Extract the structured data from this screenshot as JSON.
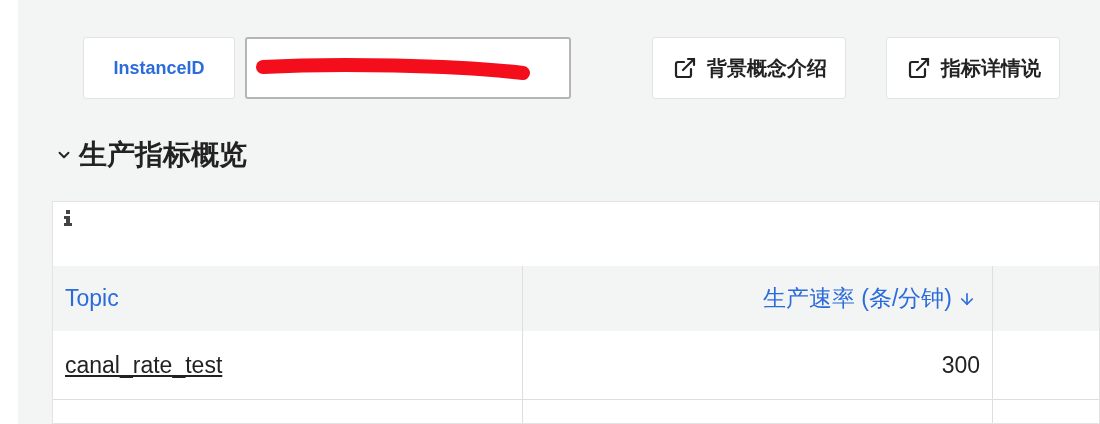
{
  "instance": {
    "label": "InstanceID",
    "redacted": true
  },
  "buttons": [
    {
      "label": "背景概念介绍"
    },
    {
      "label": "指标详情说"
    }
  ],
  "section": {
    "title": "生产指标概览",
    "expanded": true
  },
  "table": {
    "columns": [
      {
        "label": "Topic",
        "kind": "text",
        "sorted": false
      },
      {
        "label": "生产速率 (条/分钟)",
        "kind": "number",
        "sorted": true
      }
    ],
    "rows": [
      {
        "cells": [
          "canal_rate_test",
          "300"
        ]
      }
    ]
  }
}
